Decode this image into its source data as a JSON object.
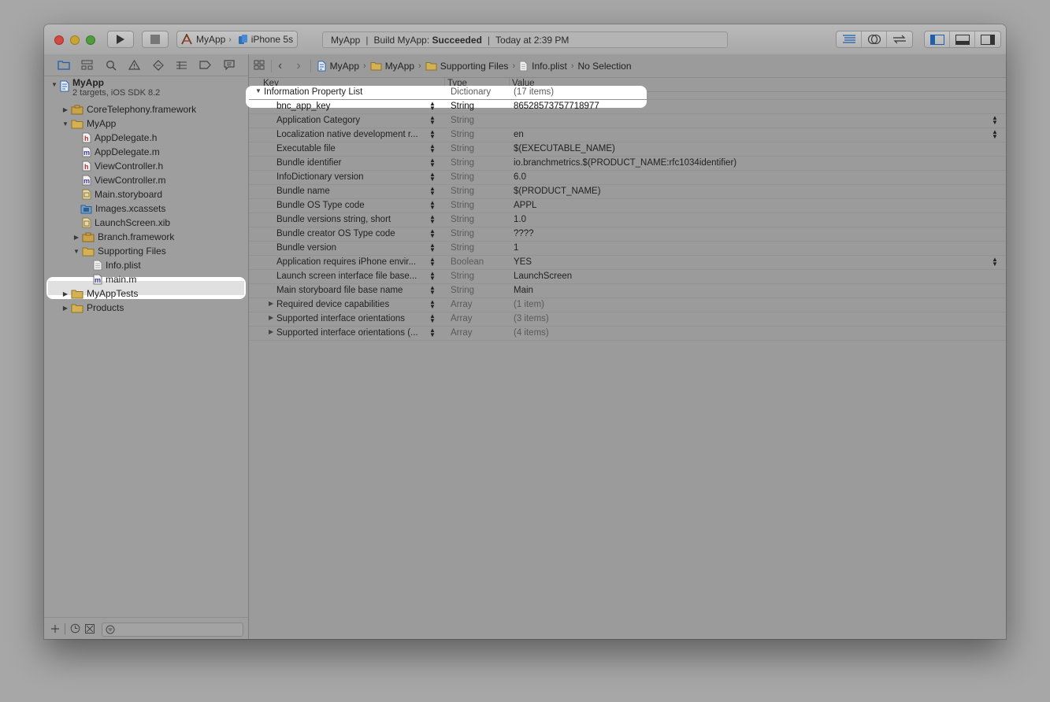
{
  "toolbar": {
    "scheme_app": "MyApp",
    "scheme_device": "iPhone 5s",
    "activity_project": "MyApp",
    "activity_build": "Build MyApp:",
    "activity_status": "Succeeded",
    "activity_time": "Today at 2:39 PM"
  },
  "navigator": {
    "project_name": "MyApp",
    "project_sub": "2 targets, iOS SDK 8.2",
    "items": [
      {
        "label": "CoreTelephony.framework"
      },
      {
        "label": "MyApp"
      },
      {
        "label": "AppDelegate.h"
      },
      {
        "label": "AppDelegate.m"
      },
      {
        "label": "ViewController.h"
      },
      {
        "label": "ViewController.m"
      },
      {
        "label": "Main.storyboard"
      },
      {
        "label": "Images.xcassets"
      },
      {
        "label": "LaunchScreen.xib"
      },
      {
        "label": "Branch.framework"
      },
      {
        "label": "Supporting Files"
      },
      {
        "label": "Info.plist"
      },
      {
        "label": "main.m"
      },
      {
        "label": "MyAppTests"
      },
      {
        "label": "Products"
      }
    ]
  },
  "jumpbar": {
    "crumbs": [
      "MyApp",
      "MyApp",
      "Supporting Files",
      "Info.plist",
      "No Selection"
    ]
  },
  "plist": {
    "headers": {
      "key": "Key",
      "type": "Type",
      "value": "Value"
    },
    "rows": [
      {
        "key": "Information Property List",
        "type": "Dictionary",
        "value": "(17 items)"
      },
      {
        "key": "bnc_app_key",
        "type": "String",
        "value": "86528573757718977"
      },
      {
        "key": "Application Category",
        "type": "String",
        "value": ""
      },
      {
        "key": "Localization native development r...",
        "type": "String",
        "value": "en"
      },
      {
        "key": "Executable file",
        "type": "String",
        "value": "$(EXECUTABLE_NAME)"
      },
      {
        "key": "Bundle identifier",
        "type": "String",
        "value": "io.branchmetrics.$(PRODUCT_NAME:rfc1034identifier)"
      },
      {
        "key": "InfoDictionary version",
        "type": "String",
        "value": "6.0"
      },
      {
        "key": "Bundle name",
        "type": "String",
        "value": "$(PRODUCT_NAME)"
      },
      {
        "key": "Bundle OS Type code",
        "type": "String",
        "value": "APPL"
      },
      {
        "key": "Bundle versions string, short",
        "type": "String",
        "value": "1.0"
      },
      {
        "key": "Bundle creator OS Type code",
        "type": "String",
        "value": "????"
      },
      {
        "key": "Bundle version",
        "type": "String",
        "value": "1"
      },
      {
        "key": "Application requires iPhone envir...",
        "type": "Boolean",
        "value": "YES"
      },
      {
        "key": "Launch screen interface file base...",
        "type": "String",
        "value": "LaunchScreen"
      },
      {
        "key": "Main storyboard file base name",
        "type": "String",
        "value": "Main"
      },
      {
        "key": "Required device capabilities",
        "type": "Array",
        "value": "(1 item)"
      },
      {
        "key": "Supported interface orientations",
        "type": "Array",
        "value": "(3 items)"
      },
      {
        "key": "Supported interface orientations (...",
        "type": "Array",
        "value": "(4 items)"
      }
    ]
  },
  "colors": {
    "background": "#a7a7a7",
    "window": "#9b9b9b",
    "highlight": "#ffffff",
    "accent_blue": "#1f5fae"
  },
  "icons": {
    "window_controls": [
      "close-icon",
      "minimize-icon",
      "zoom-icon"
    ],
    "run": "play-icon",
    "stop": "stop-icon",
    "navigator_tabs": [
      "folder-icon",
      "hierarchy-icon",
      "search-icon",
      "warning-icon",
      "test-diamond-icon",
      "list-icon",
      "breakpoint-icon",
      "message-icon"
    ]
  }
}
